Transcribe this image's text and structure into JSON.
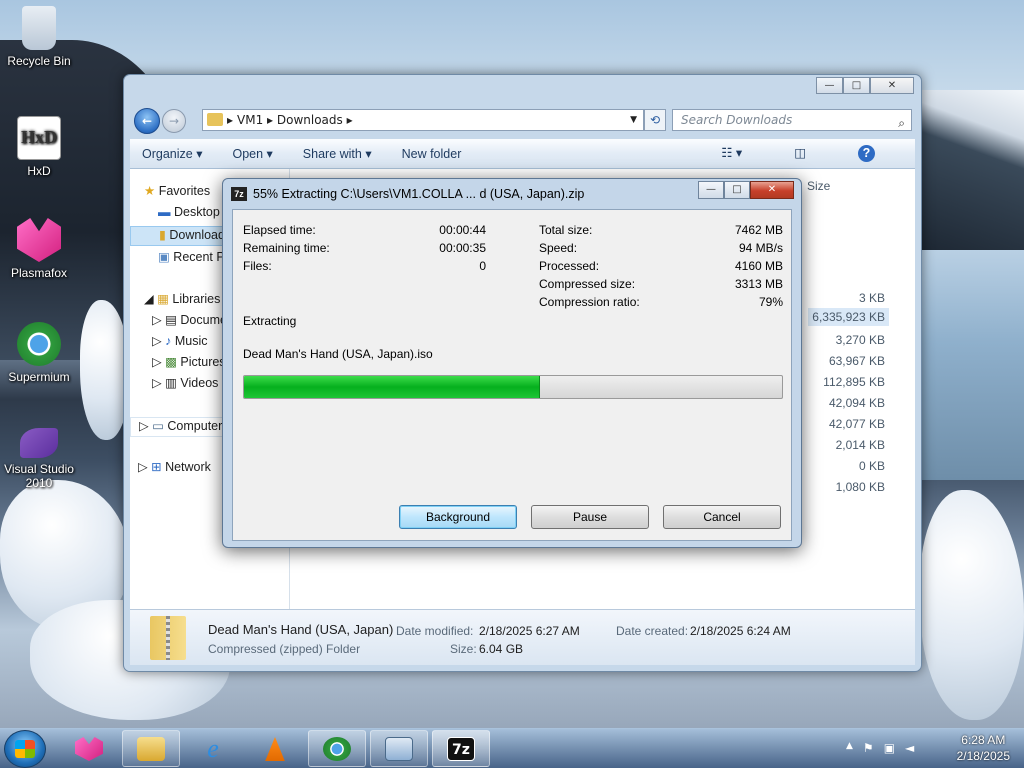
{
  "desktop": {
    "icons": [
      {
        "label": "Recycle Bin"
      },
      {
        "label": "HxD"
      },
      {
        "label": "Plasmafox"
      },
      {
        "label": "Supermium"
      },
      {
        "label": "Visual Studio 2010"
      }
    ]
  },
  "explorer": {
    "address": {
      "seg1": "VM1",
      "seg2": "Downloads"
    },
    "search_placeholder": "Search Downloads",
    "toolbar": {
      "organize": "Organize ▾",
      "open": "Open ▾",
      "share": "Share with ▾",
      "new_folder": "New folder"
    },
    "nav": {
      "favorites": "Favorites",
      "desktop": "Desktop",
      "downloads": "Downloads",
      "recent": "Recent Places",
      "libraries": "Libraries",
      "documents": "Documents",
      "music": "Music",
      "pictures": "Pictures",
      "videos": "Videos",
      "computer": "Computer",
      "network": "Network"
    },
    "size_header": "Size",
    "sizes": [
      "3 KB",
      "6,335,923 KB",
      "3,270 KB",
      "63,967 KB",
      "112,895 KB",
      "42,094 KB",
      "42,077 KB",
      "2,014 KB",
      "0 KB",
      "1,080 KB"
    ],
    "details": {
      "name": "Dead Man's Hand (USA, Japan)",
      "type": "Compressed (zipped) Folder",
      "modified_label": "Date modified:",
      "modified_value": "2/18/2025 6:27 AM",
      "created_label": "Date created:",
      "created_value": "2/18/2025 6:24 AM",
      "size_label": "Size:",
      "size_value": "6.04 GB"
    }
  },
  "dialog": {
    "title": "55% Extracting C:\\Users\\VM1.COLLA ... d (USA, Japan).zip",
    "logo": "7z",
    "elapsed_label": "Elapsed time:",
    "elapsed_value": "00:00:44",
    "remaining_label": "Remaining time:",
    "remaining_value": "00:00:35",
    "files_label": "Files:",
    "files_value": "0",
    "total_label": "Total size:",
    "total_value": "7462 MB",
    "speed_label": "Speed:",
    "speed_value": "94 MB/s",
    "processed_label": "Processed:",
    "processed_value": "4160 MB",
    "compressed_label": "Compressed size:",
    "compressed_value": "3313 MB",
    "ratio_label": "Compression ratio:",
    "ratio_value": "79%",
    "status": "Extracting",
    "current_file": "Dead Man's Hand (USA, Japan).iso",
    "progress": 0.55,
    "buttons": {
      "background": "Background",
      "pause": "Pause",
      "cancel": "Cancel"
    }
  },
  "taskbar": {
    "time": "6:28 AM",
    "date": "2/18/2025",
    "apps": [
      "start-button",
      "plasmafox",
      "explorer",
      "internet-explorer",
      "vlc",
      "supermium",
      "control-panel",
      "7zip"
    ],
    "tray_arrow": "▲"
  },
  "colors": {
    "progress_fill": "#06b01e",
    "dialog_frame": "#c4d6e9",
    "default_button": "#bee6fd"
  }
}
